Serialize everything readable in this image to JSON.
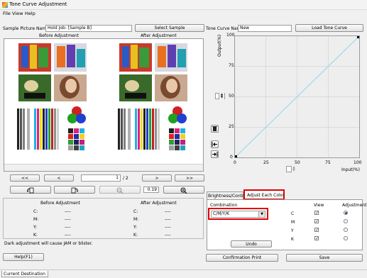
{
  "window": {
    "title": "Tone Curve Adjustment"
  },
  "menu": [
    "File",
    "View",
    "Help"
  ],
  "sample": {
    "label": "Sample Picture Name",
    "value": "Hold Job: [Sample B]",
    "select_button": "Select Sample",
    "before_label": "Before Adjustment",
    "after_label": "After Adjustment"
  },
  "tonecurve": {
    "label": "Tone Curve Name",
    "value": "New",
    "load_button": "Load Tone Curve",
    "output_label": "Output(%)",
    "input_label": "Input(%)",
    "y_ticks": [
      "100",
      "75",
      "50",
      "25",
      "0"
    ],
    "x_ticks": [
      "0",
      "25",
      "50",
      "75",
      "100"
    ],
    "output_value": "0",
    "input_value": "0"
  },
  "navigation": {
    "first": "<<",
    "prev": "<",
    "page_current": "1",
    "page_total": "/ 2",
    "next": ">",
    "last": ">>",
    "zoom_value": "0.19"
  },
  "density_table": {
    "before_header": "Before Adjustment",
    "after_header": "After Adjustment",
    "rows": [
      {
        "label": "C:",
        "before": "----",
        "after": "----"
      },
      {
        "label": "M:",
        "before": "----",
        "after": "----"
      },
      {
        "label": "Y:",
        "before": "----",
        "after": "----"
      },
      {
        "label": "K:",
        "before": "----",
        "after": "----"
      }
    ],
    "warning": "Dark adjustment will cause JAM or blister."
  },
  "tabs": [
    {
      "label": "Brightness/Contrast"
    },
    {
      "label": "Adjust Each Color"
    }
  ],
  "adjust_each_color": {
    "combination_label": "Combination",
    "combination_value": "C/M/Y/K",
    "view_header": "View",
    "adjustment_header": "Adjustment",
    "channels": [
      {
        "name": "C",
        "view": true,
        "adjust": true
      },
      {
        "name": "M",
        "view": true,
        "adjust": false
      },
      {
        "name": "Y",
        "view": true,
        "adjust": false
      },
      {
        "name": "K",
        "view": true,
        "adjust": false
      }
    ],
    "undo_button": "Undo"
  },
  "buttons": {
    "help": "Help(F1)",
    "confirmation_print": "Confirmation Print",
    "save": "Save"
  },
  "status": {
    "tab": "Current Destination"
  },
  "colors": {
    "curve": "#8ed8e8",
    "highlight": "#e00000",
    "panel_bg": "#f0f0f0"
  }
}
